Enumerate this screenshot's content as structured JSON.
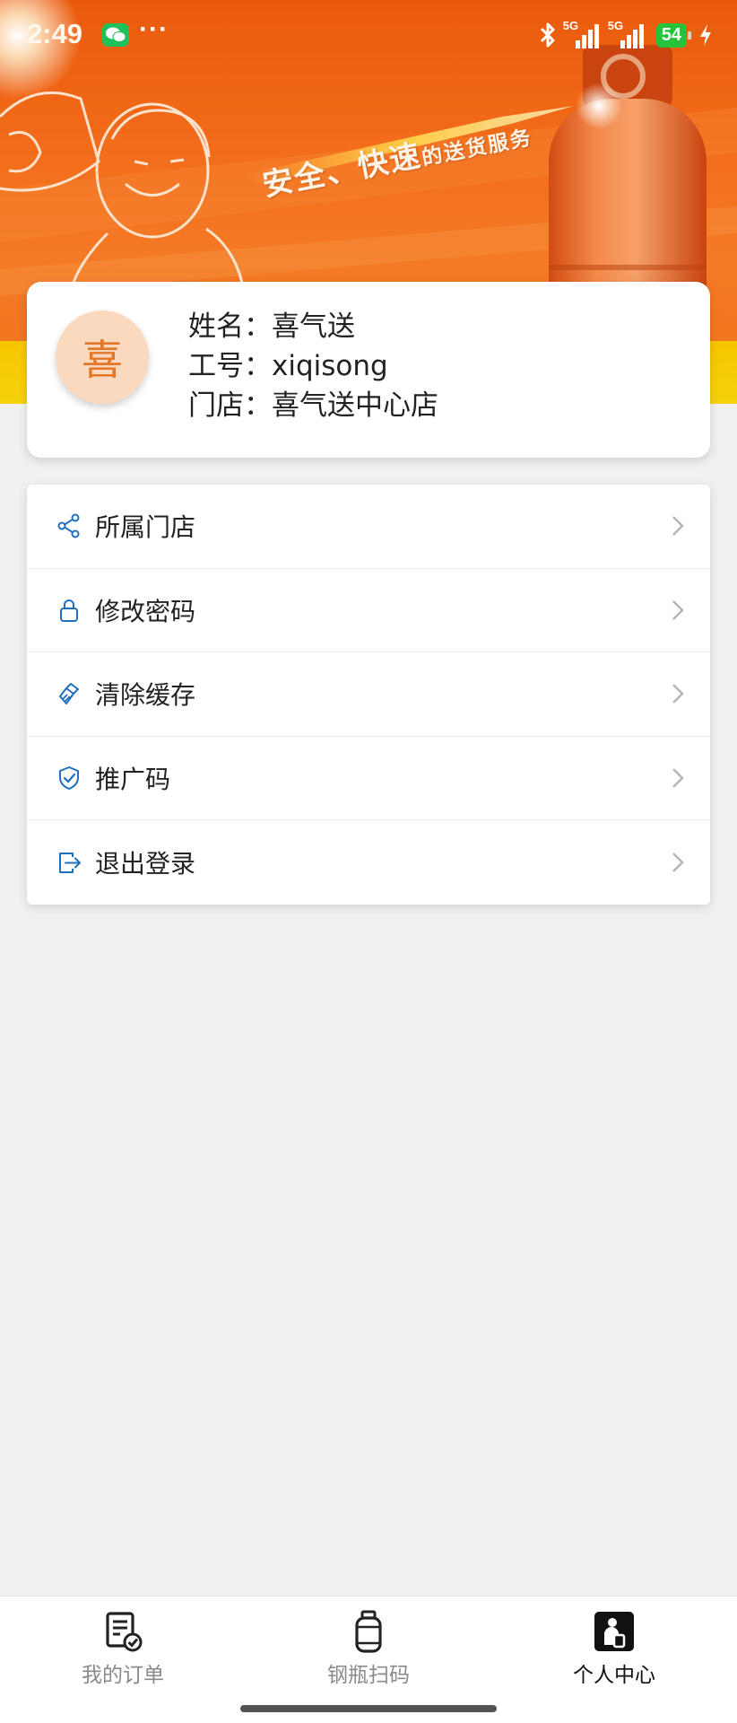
{
  "status_bar": {
    "time": "2:49",
    "dots": "···",
    "network_1": "5G",
    "network_2": "5G",
    "battery": "54"
  },
  "banner": {
    "slogan_main": "安全、快速",
    "slogan_small": "的送货服务"
  },
  "profile": {
    "avatar_char": "喜",
    "name_label": "姓名：",
    "name": "喜气送",
    "id_label": "工号：",
    "id": "xiqisong",
    "store_label": "门店：",
    "store": "喜气送中心店"
  },
  "menu": {
    "items": [
      {
        "label": "所属门店",
        "icon": "share-icon"
      },
      {
        "label": "修改密码",
        "icon": "lock-icon"
      },
      {
        "label": "清除缓存",
        "icon": "broom-icon"
      },
      {
        "label": "推广码",
        "icon": "shield-check-icon"
      },
      {
        "label": "退出登录",
        "icon": "logout-icon"
      }
    ]
  },
  "bottom_nav": {
    "items": [
      {
        "label": "我的订单",
        "icon": "order-list-icon",
        "active": false
      },
      {
        "label": "钢瓶扫码",
        "icon": "gas-cylinder-icon",
        "active": false
      },
      {
        "label": "个人中心",
        "icon": "profile-icon",
        "active": true
      }
    ]
  },
  "colors": {
    "banner_orange": "#f36e1c",
    "banner_yellow": "#f7c500",
    "icon_blue": "#1f6fc1",
    "avatar_bg": "#fbd9bf",
    "avatar_text": "#e37628"
  }
}
